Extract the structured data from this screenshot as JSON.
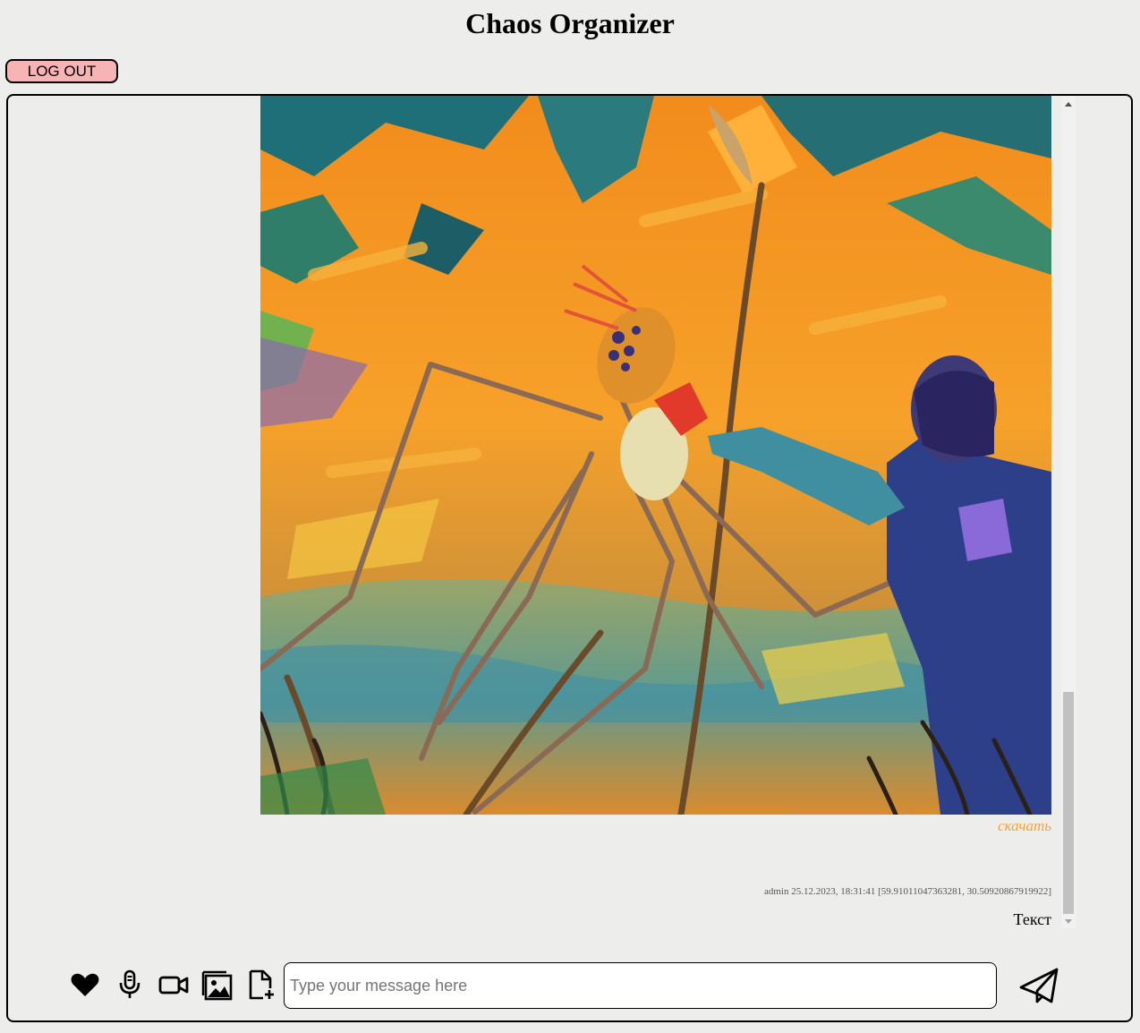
{
  "app": {
    "title": "Chaos Organizer"
  },
  "header": {
    "logout_label": "LOG OUT"
  },
  "message": {
    "download_label": "скачать",
    "meta": "admin 25.12.2023, 18:31:41 [59.91011047363281, 30.50920867919922]",
    "text": "Текст"
  },
  "composer": {
    "placeholder": "Type your message here",
    "icons": [
      "heart-icon",
      "microphone-icon",
      "video-camera-icon",
      "image-icon",
      "file-add-icon",
      "send-icon"
    ]
  },
  "colors": {
    "background": "#edeeeb",
    "logout_button": "#f8b4b4",
    "download_link": "#f4a338"
  }
}
